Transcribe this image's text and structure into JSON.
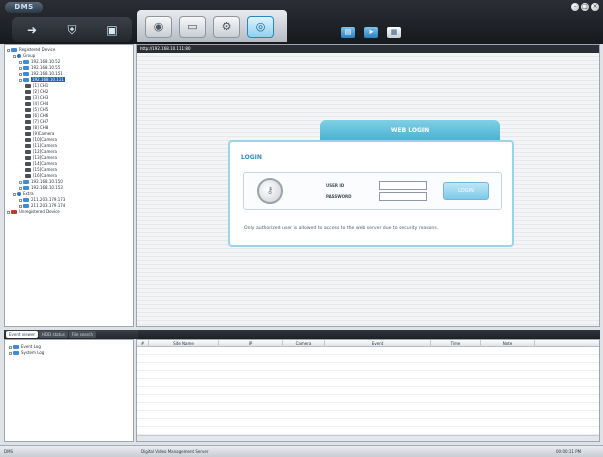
{
  "app": {
    "logo_text": "DMS",
    "window_buttons": [
      "–",
      "□",
      "×"
    ]
  },
  "top_tools": {
    "left": [
      "pin-icon",
      "shield-icon",
      "picture-icon"
    ],
    "center": [
      "camera-icon",
      "monitor-icon",
      "settings-icon",
      "globe-icon"
    ],
    "right": [
      "save-icon",
      "export-icon",
      "doc-icon"
    ]
  },
  "tree": [
    {
      "label": "Registered Device",
      "indent": 0,
      "icon": "dev"
    },
    {
      "label": "Group",
      "indent": 1,
      "icon": "blue"
    },
    {
      "label": "192.168.10.52",
      "indent": 2,
      "icon": "dev"
    },
    {
      "label": "192.168.10.55",
      "indent": 2,
      "icon": "dev"
    },
    {
      "label": "192.168.10.151",
      "indent": 2,
      "icon": "dev"
    },
    {
      "label": "192.168.10.111",
      "indent": 2,
      "icon": "dev",
      "selected": true
    },
    {
      "label": "[1] CH1",
      "indent": 3,
      "icon": "cam"
    },
    {
      "label": "[2] CH2",
      "indent": 3,
      "icon": "cam"
    },
    {
      "label": "[3] CH3",
      "indent": 3,
      "icon": "cam"
    },
    {
      "label": "[4] CH4",
      "indent": 3,
      "icon": "cam"
    },
    {
      "label": "[5] CH5",
      "indent": 3,
      "icon": "cam"
    },
    {
      "label": "[6] CH6",
      "indent": 3,
      "icon": "cam"
    },
    {
      "label": "[7] CH7",
      "indent": 3,
      "icon": "cam"
    },
    {
      "label": "[8] CH8",
      "indent": 3,
      "icon": "cam"
    },
    {
      "label": "[9]Camera",
      "indent": 3,
      "icon": "cam"
    },
    {
      "label": "[10]Camera",
      "indent": 3,
      "icon": "cam"
    },
    {
      "label": "[11]Camera",
      "indent": 3,
      "icon": "cam"
    },
    {
      "label": "[12]Camera",
      "indent": 3,
      "icon": "cam"
    },
    {
      "label": "[13]Camera",
      "indent": 3,
      "icon": "cam"
    },
    {
      "label": "[14]Camera",
      "indent": 3,
      "icon": "cam"
    },
    {
      "label": "[15]Camera",
      "indent": 3,
      "icon": "cam"
    },
    {
      "label": "[16]Camera",
      "indent": 3,
      "icon": "cam"
    },
    {
      "label": "192.168.10.150",
      "indent": 2,
      "icon": "dev"
    },
    {
      "label": "192.168.10.153",
      "indent": 2,
      "icon": "dev"
    },
    {
      "label": "Extra",
      "indent": 1,
      "icon": "blue"
    },
    {
      "label": "211.203.179.173",
      "indent": 2,
      "icon": "dev"
    },
    {
      "label": "211.203.179.174",
      "indent": 2,
      "icon": "dev"
    },
    {
      "label": "Unregistered Device",
      "indent": 0,
      "icon": "red"
    }
  ],
  "browser": {
    "address": "http://192.168.10.111:80",
    "login": {
      "tab_title": "WEB LOGIN",
      "heading": "LOGIN",
      "user_label": "USER ID",
      "password_label": "PASSWORD",
      "user_value": "",
      "password_value": "",
      "button_label": "LOGIN",
      "notice": "Only authorized user is allowed to access to the web server due to security reasons."
    }
  },
  "bottom_tabs": [
    "Event viewer",
    "HDD status",
    "File search"
  ],
  "log_tree": [
    "Event Log",
    "System Log"
  ],
  "log_columns": [
    "#",
    "Site Name",
    "IP",
    "Camera",
    "Event",
    "Time",
    "Note"
  ],
  "status": {
    "left": "DMS",
    "center": "Digital Video Management Server",
    "right": "00:00:11 PM"
  },
  "colors": {
    "accent": "#49b0d1",
    "selection": "#2a5fb8",
    "chrome": "#23272d"
  }
}
